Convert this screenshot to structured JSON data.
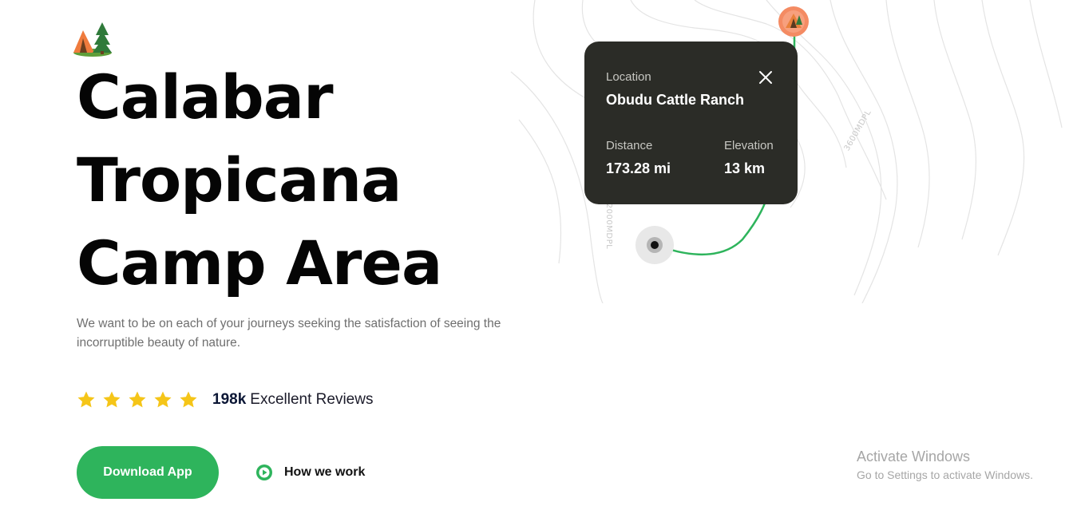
{
  "hero": {
    "title_lines": [
      "Calabar",
      "Tropicana",
      "Camp Area"
    ],
    "description": "We want to be on each of your journeys seeking the satisfaction of seeing the incorruptible beauty of nature.",
    "rating": {
      "stars": 5,
      "count": "198k",
      "label": "Excellent Reviews",
      "star_color": "#f5c518"
    },
    "download_label": "Download App",
    "how_label": "How we work",
    "accent_color": "#2eb45c",
    "logo_icon": "camping-tent-icon"
  },
  "map": {
    "contour_labels": [
      "3600MDPL",
      "2000MDPL"
    ],
    "route_color": "#2eb45c",
    "pin_icon": "camping-pin-icon",
    "origin_icon": "location-dot-icon"
  },
  "location_card": {
    "location_label": "Location",
    "location_name": "Obudu Cattle Ranch",
    "distance_label": "Distance",
    "distance_value": "173.28 mi",
    "elevation_label": "Elevation",
    "elevation_value": "13 km",
    "close_icon": "close-icon"
  },
  "watermark": {
    "title": "Activate Windows",
    "subtitle": "Go to Settings to activate Windows."
  }
}
